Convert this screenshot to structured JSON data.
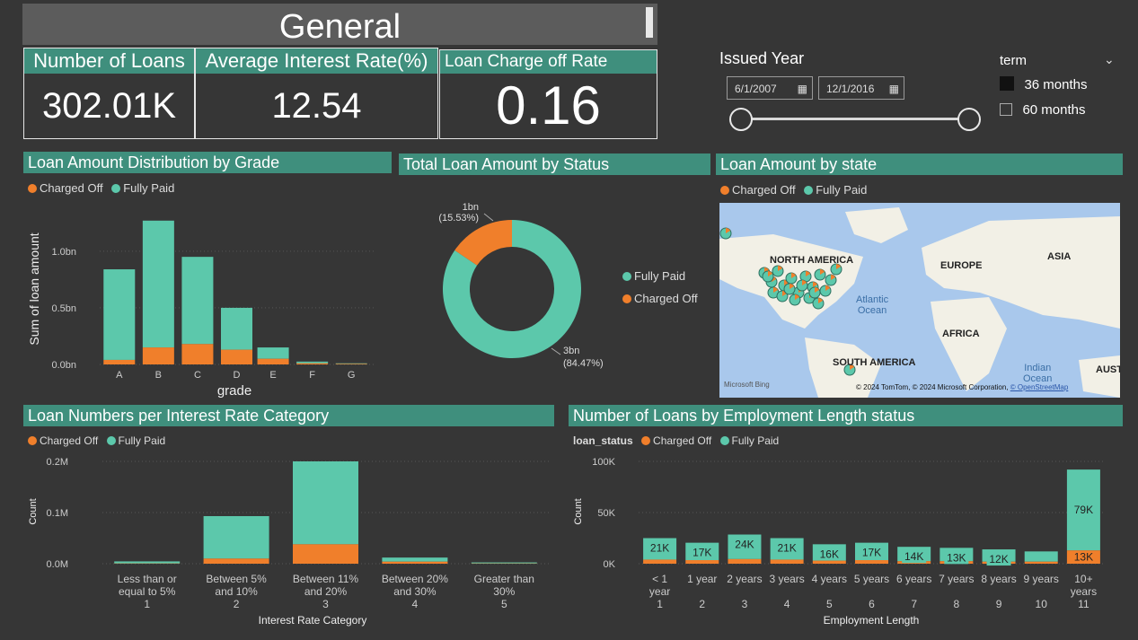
{
  "colors": {
    "teal": "#5cc8ab",
    "orange": "#f07f2b",
    "header_teal": "#3f8f7d",
    "bg": "#363636"
  },
  "title": "General",
  "kpis": [
    {
      "label": "Number of Loans",
      "value": "302.01K"
    },
    {
      "label": "Average Interest Rate(%)",
      "value": "12.54"
    },
    {
      "label": "Loan Charge off Rate",
      "value": "0.16"
    }
  ],
  "filters": {
    "issued_year": {
      "label": "Issued Year",
      "start": "6/1/2007",
      "end": "12/1/2016",
      "icon": "calendar-icon"
    },
    "term": {
      "label": "term",
      "options": [
        {
          "label": "36 months",
          "checked": true
        },
        {
          "label": "60 months",
          "checked": false
        }
      ],
      "icon": "chevron-down-icon"
    }
  },
  "legend": {
    "charged_off": "Charged Off",
    "fully_paid": "Fully Paid",
    "loan_status": "loan_status"
  },
  "grade_chart": {
    "header": "Loan Amount Distribution by Grade",
    "chart_data": {
      "type": "bar",
      "stacked": true,
      "categories": [
        "A",
        "B",
        "C",
        "D",
        "E",
        "F",
        "G"
      ],
      "series": [
        {
          "name": "Charged Off",
          "values": [
            0.04,
            0.15,
            0.18,
            0.13,
            0.05,
            0.01,
            0.005
          ]
        },
        {
          "name": "Fully Paid",
          "values": [
            0.8,
            1.12,
            0.77,
            0.37,
            0.1,
            0.015,
            0.005
          ]
        }
      ],
      "xlabel": "grade",
      "ylabel": "Sum of loan amount",
      "yticks": [
        "0.0bn",
        "0.5bn",
        "1.0bn"
      ],
      "ylim": [
        0,
        1.3
      ]
    }
  },
  "status_chart": {
    "header": "Total Loan Amount by Status",
    "chart_data": {
      "type": "pie",
      "donut": true,
      "slices": [
        {
          "name": "Fully Paid",
          "value": 84.47,
          "label": "3bn",
          "pct": "(84.47%)"
        },
        {
          "name": "Charged Off",
          "value": 15.53,
          "label": "1bn",
          "pct": "(15.53%)"
        }
      ]
    }
  },
  "map": {
    "header": "Loan Amount by state",
    "labels": {
      "na": "NORTH AMERICA",
      "eu": "EUROPE",
      "asia": "ASIA",
      "atlantic": "Atlantic\nOcean",
      "africa": "AFRICA",
      "sa": "SOUTH AMERICA",
      "indian": "Indian\nOcean",
      "aus": "AUSTRA"
    },
    "attribution": "© 2024 TomTom, © 2024 Microsoft Corporation,",
    "osm": "© OpenStreetMap",
    "bing": "Microsoft Bing"
  },
  "rate_chart": {
    "header": "Loan Numbers per Interest Rate Category",
    "chart_data": {
      "type": "bar",
      "stacked": true,
      "categories": [
        "Less than or equal to 5%",
        "Between 5% and 10%",
        "Between 11% and 20%",
        "Between 20% and 30%",
        "Greater than 30%"
      ],
      "category_lines": [
        [
          "Less than or",
          "equal to 5%"
        ],
        [
          "Between 5%",
          "and 10%"
        ],
        [
          "Between 11%",
          "and 20%"
        ],
        [
          "Between 20%",
          "and 30%"
        ],
        [
          "Greater than",
          "30%"
        ]
      ],
      "category_index": [
        "1",
        "2",
        "3",
        "4",
        "5"
      ],
      "series": [
        {
          "name": "Charged Off",
          "values": [
            0.0005,
            0.01,
            0.038,
            0.004,
            0.0005
          ]
        },
        {
          "name": "Fully Paid",
          "values": [
            0.004,
            0.083,
            0.162,
            0.008,
            0.002
          ]
        }
      ],
      "xlabel": "Interest Rate Category",
      "ylabel": "Count",
      "yticks": [
        "0.0M",
        "0.1M",
        "0.2M"
      ],
      "ylim": [
        0,
        0.2
      ]
    }
  },
  "emp_chart": {
    "header": "Number of Loans by Employment Length status",
    "chart_data": {
      "type": "bar",
      "stacked": true,
      "category_lines": [
        [
          "< 1",
          "year"
        ],
        [
          "1 year"
        ],
        [
          "2 years"
        ],
        [
          "3 years"
        ],
        [
          "4 years"
        ],
        [
          "5 years"
        ],
        [
          "6 years"
        ],
        [
          "7 years"
        ],
        [
          "8 years"
        ],
        [
          "9 years"
        ],
        [
          "10+",
          "years"
        ]
      ],
      "category_index": [
        "1",
        "2",
        "3",
        "4",
        "5",
        "6",
        "7",
        "8",
        "9",
        "10",
        "11"
      ],
      "series": [
        {
          "name": "Charged Off",
          "values": [
            4,
            3.5,
            4.5,
            4,
            3,
            3.5,
            2.5,
            2.5,
            2,
            2,
            13
          ]
        },
        {
          "name": "Fully Paid",
          "values": [
            21,
            17,
            24,
            21,
            16,
            17,
            14,
            13,
            12,
            10,
            79
          ]
        }
      ],
      "bar_labels": [
        "21K",
        "17K",
        "24K",
        "21K",
        "16K",
        "17K",
        "14K",
        "13K",
        "12K",
        "",
        "79K"
      ],
      "co_labels": [
        "",
        "",
        "",
        "",
        "",
        "",
        "",
        "",
        "",
        "",
        "13K"
      ],
      "xlabel": "Employment Length",
      "ylabel": "Count",
      "yticks": [
        "0K",
        "50K",
        "100K"
      ],
      "ylim": [
        0,
        100
      ]
    }
  }
}
